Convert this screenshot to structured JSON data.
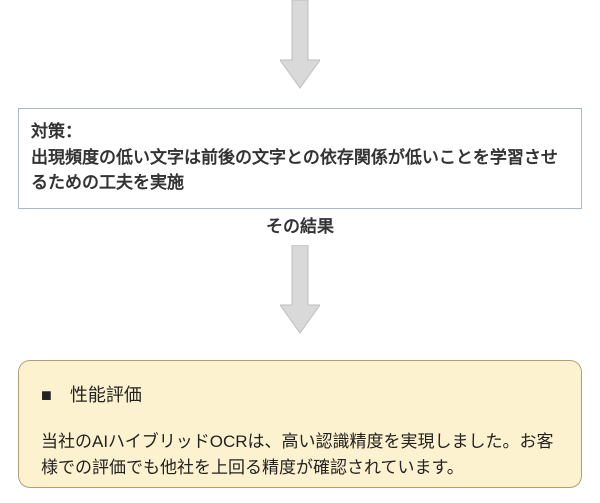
{
  "arrow_color": "#d9d9d9",
  "arrow_stroke": "#bfbfbf",
  "countermeasure": {
    "title": "対策：",
    "body": "出現頻度の低い文字は前後の文字との依存関係が低いことを学習させるための工夫を実施"
  },
  "result_label": "その結果",
  "evaluation": {
    "title": "■　性能評価",
    "body": "当社のAIハイブリッドOCRは、高い認識精度を実現しました。お客様での評価でも他社を上回る精度が確認されています。"
  }
}
